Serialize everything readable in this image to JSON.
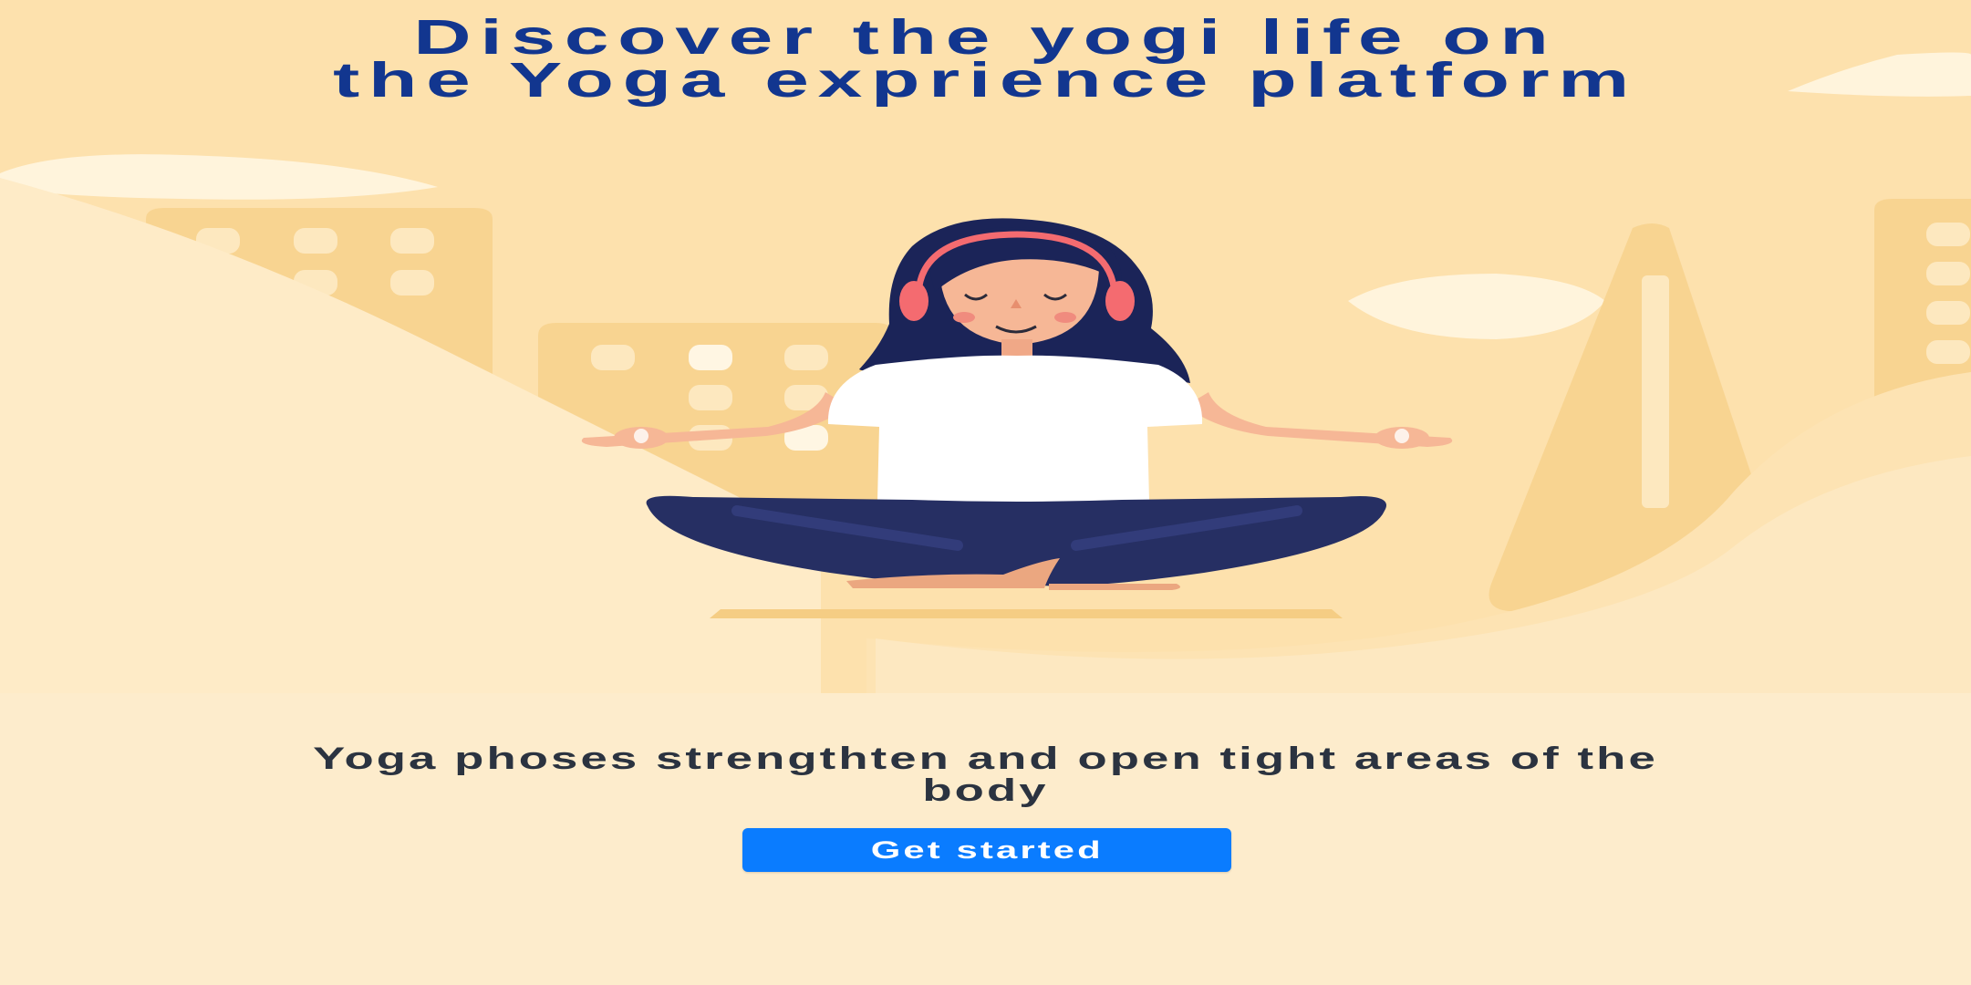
{
  "hero": {
    "title_line1": "Discover the yogi life on",
    "title_line2": "the Yoga exprience platform"
  },
  "subtitle": {
    "line1": "Yoga phoses strengthten and open tight areas of the",
    "line2": "body"
  },
  "cta": {
    "label": "Get started"
  },
  "colors": {
    "background": "#fdeccc",
    "title": "#12368f",
    "subtitle": "#2b3340",
    "button": "#0a7cff",
    "button_text": "#ffffff"
  },
  "illustration": {
    "subject": "meditating-woman-with-headphones",
    "icons": [
      "cloud-icon",
      "building-icon",
      "cone-tree-icon",
      "hill-icon"
    ]
  }
}
